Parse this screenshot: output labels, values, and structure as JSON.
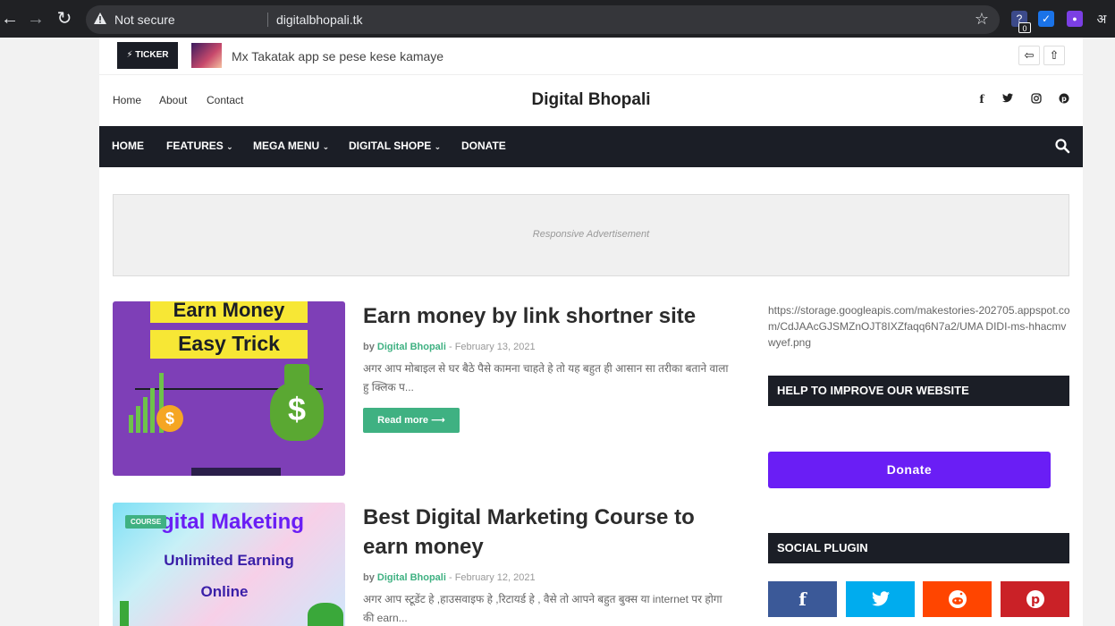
{
  "browser": {
    "security_label": "Not secure",
    "url": "digitalbhopali.tk",
    "extension_badge": "0",
    "extension_letter": "अ"
  },
  "ticker": {
    "label": "TICKER",
    "headline": "Mx Takatak app se pese kese kamaye"
  },
  "header": {
    "top_links": [
      "Home",
      "About",
      "Contact"
    ],
    "site_title": "Digital Bhopali",
    "social_icons": [
      "facebook-icon",
      "twitter-icon",
      "instagram-icon",
      "pinterest-icon"
    ]
  },
  "nav": {
    "items": [
      "HOME",
      "FEATURES",
      "MEGA MENU",
      "DIGITAL SHOPE",
      "DONATE"
    ]
  },
  "ad": {
    "label": "Responsive Advertisement"
  },
  "posts": [
    {
      "title": "Earn money by link shortner site",
      "by": "by",
      "author": "Digital Bhopali",
      "date": "- February 13, 2021",
      "snippet": "अगर आप मोबाइल से घर बैठे पैसे कामना चाहते हे तो यह बहुत ही आसान सा तरीका बताने वाला हु   क्लिक  प...",
      "read_more": "Read more",
      "thumb_line1": "Earn Money",
      "thumb_line2": "Easy Trick"
    },
    {
      "title": "Best Digital Marketing Course to earn money",
      "by": "by",
      "author": "Digital Bhopali",
      "date": "- February 12, 2021",
      "snippet": "अगर आप स्टूडेंट हे ,हाउसवाइफ हे ,रिटायर्ड हे , वैसे तो आपने बहुत बुक्स या internet पर  होगा की earn...",
      "badge": "COURSE",
      "thumb_line1": "gital Maketing",
      "thumb_line2": "Unlimited Earning",
      "thumb_line3": "Online"
    }
  ],
  "sidebar": {
    "image_link": "https://storage.googleapis.com/makestories-202705.appspot.com/CdJAAcGJSMZnOJT8IXZfaqq6N7a2/UMA DIDI-ms-hhacmvwyef.png",
    "help_heading": "HELP TO IMPROVE OUR WEBSITE",
    "donate_label": "Donate",
    "social_heading": "SOCIAL PLUGIN",
    "social_buttons": [
      {
        "name": "facebook",
        "color": "#3b5998"
      },
      {
        "name": "twitter",
        "color": "#00acee"
      },
      {
        "name": "reddit",
        "color": "#ff4500"
      },
      {
        "name": "pinterest",
        "color": "#ca2127"
      }
    ]
  },
  "colors": {
    "dark": "#1b1e26",
    "accent_green": "#3fb182",
    "donate_purple": "#6a1ef5"
  }
}
